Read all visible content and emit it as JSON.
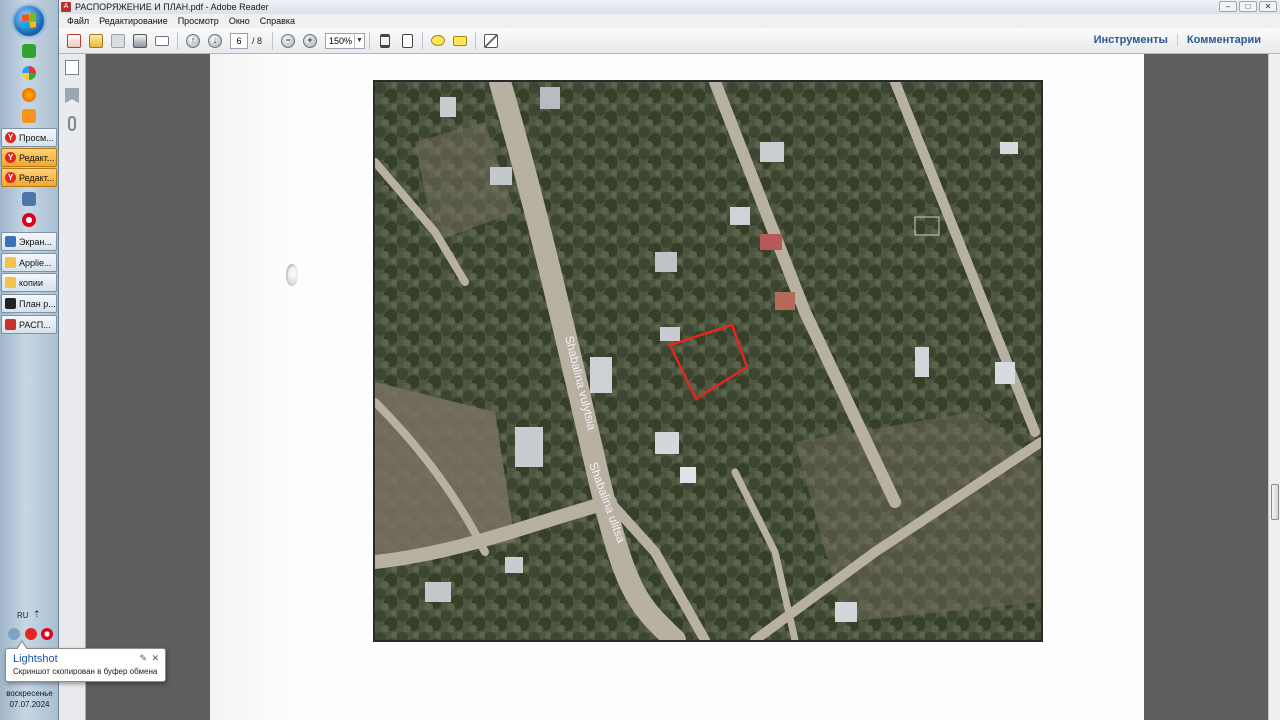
{
  "window": {
    "title": "РАСПОРЯЖЕНИЕ И ПЛАН.pdf - Adobe Reader",
    "controls": {
      "minimize": "–",
      "maximize": "□",
      "close": "✕"
    }
  },
  "menu": {
    "items": [
      "Файл",
      "Редактирование",
      "Просмотр",
      "Окно",
      "Справка"
    ]
  },
  "toolbar": {
    "page_current": "6",
    "page_total": "/ 8",
    "zoom": "150%",
    "tools_label": "Инструменты",
    "comments_label": "Комментарии"
  },
  "taskbar": {
    "items": [
      {
        "label": "Просм...",
        "icon": "yandex-icon",
        "active": false
      },
      {
        "label": "Редакт...",
        "icon": "yandex-icon",
        "active": true
      },
      {
        "label": "Редакт...",
        "icon": "yandex-icon",
        "active": true
      },
      {
        "label": "Экран...",
        "icon": "window-icon",
        "active": false
      },
      {
        "label": "Applie...",
        "icon": "folder-icon",
        "active": false
      },
      {
        "label": "копии",
        "icon": "folder-icon",
        "active": false
      },
      {
        "label": "План р...",
        "icon": "app-icon",
        "active": false
      },
      {
        "label": "РАСП...",
        "icon": "pdf-icon",
        "active": false
      }
    ],
    "tray_lang": "RU",
    "clock_day": "воскресенье",
    "clock_date": "07.07.2024"
  },
  "notification": {
    "title": "Lightshot",
    "message": "Скриншот скопирован в буфер обмена",
    "pin": "✎",
    "close": "✕"
  },
  "map": {
    "street_label_1": "Shabalina vulytsia",
    "street_label_2": "Shabalina ulitsa"
  },
  "colors": {
    "plot_outline": "#e3261e",
    "accent_link": "#2a5a8e",
    "active_task": "#f2a72a"
  }
}
